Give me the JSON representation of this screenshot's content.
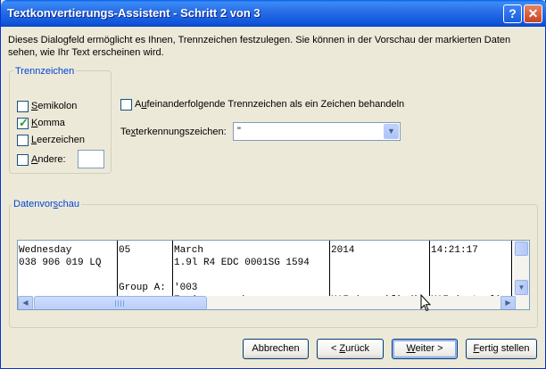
{
  "window": {
    "title": "Textkonvertierungs-Assistent - Schritt 2 von 3",
    "help_glyph": "?",
    "close_glyph": "✕"
  },
  "intro": "Dieses Dialogfeld ermöglicht es Ihnen, Trennzeichen festzulegen. Sie können in der Vorschau der markierten Daten sehen, wie Ihr Text erscheinen wird.",
  "delimiters": {
    "legend": "Trennzeichen",
    "semicolon": {
      "hotkey": "S",
      "rest": "emikolon",
      "checked": false
    },
    "comma": {
      "hotkey": "K",
      "rest": "omma",
      "checked": true
    },
    "space": {
      "hotkey": "L",
      "rest": "eerzeichen",
      "checked": false
    },
    "other": {
      "hotkey": "A",
      "rest": "ndere:",
      "checked": false,
      "value": ""
    }
  },
  "consecutive": {
    "hotkey": "u",
    "rest": "feinanderfolgende Trennzeichen als ein Zeichen behandeln",
    "checked": false
  },
  "text_qualifier": {
    "pre": "Te",
    "hotkey": "x",
    "rest": "terkennungszeichen:",
    "value": "\""
  },
  "preview": {
    "legend_pre": "Datenvor",
    "legend_hotkey": "s",
    "legend_rest": "chau",
    "rows": [
      [
        "Wednesday",
        "05",
        "March",
        "2014",
        "14:21:17"
      ],
      [
        "038 906 019 LQ",
        "",
        "1.9l R4 EDC 0001SG  1594",
        "",
        ""
      ],
      [
        "",
        "",
        "",
        "",
        ""
      ],
      [
        "",
        "Group A:",
        "'003",
        "",
        ""
      ],
      [
        "",
        "",
        "Engine speed",
        "MAF (specified)",
        "MAF (actual)"
      ]
    ]
  },
  "scroll_glyphs": {
    "left": "◀",
    "right": "▶",
    "down": "▼"
  },
  "buttons": {
    "cancel": {
      "pre": "Abbrechen",
      "hotkey": "",
      "rest": ""
    },
    "back": {
      "pre": "< ",
      "hotkey": "Z",
      "rest": "urück"
    },
    "next": {
      "pre": "",
      "hotkey": "W",
      "rest": "eiter >"
    },
    "finish": {
      "pre": "",
      "hotkey": "F",
      "rest": "ertig stellen"
    }
  },
  "check_glyph": "✓",
  "combo_arrow": "▼",
  "colors": {
    "title_bar": "#0a5ee8",
    "legend_text": "#0046d5",
    "dialog_bg": "#ece9d8"
  }
}
